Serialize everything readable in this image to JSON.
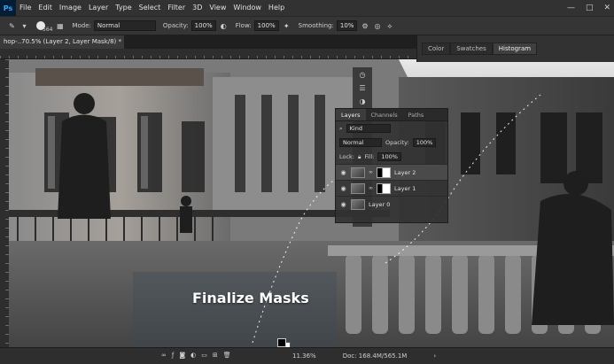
{
  "app": {
    "logo": "Ps"
  },
  "menu": [
    "File",
    "Edit",
    "Image",
    "Layer",
    "Type",
    "Select",
    "Filter",
    "3D",
    "View",
    "Window",
    "Help"
  ],
  "window_controls": [
    "—",
    "□",
    "✕"
  ],
  "options": {
    "brush_size": "564",
    "mode_label": "Mode:",
    "mode_value": "Normal",
    "opacity_label": "Opacity:",
    "opacity_value": "100%",
    "flow_label": "Flow:",
    "flow_value": "100%",
    "smoothing_label": "Smoothing:",
    "smoothing_value": "10%"
  },
  "doc_tab": {
    "title": "hop-..70.5% (Layer 2, Layer Mask/8) *",
    "close": "✕"
  },
  "right_panel": {
    "tabs": [
      "Color",
      "Swatches",
      "Histogram"
    ],
    "active": 2
  },
  "layers_panel": {
    "tabs": [
      "Layers",
      "Channels",
      "Paths"
    ],
    "kind": "Kind",
    "blend_mode": "Normal",
    "opacity_label": "Opacity:",
    "opacity_value": "100%",
    "lock_label": "Lock:",
    "fill_label": "Fill:",
    "fill_value": "100%",
    "layers": [
      {
        "name": "Layer 2",
        "has_mask": true,
        "selected": true
      },
      {
        "name": "Layer 1",
        "has_mask": true,
        "selected": false
      },
      {
        "name": "Layer 0",
        "has_mask": false,
        "selected": false
      }
    ]
  },
  "status": {
    "zoom": "11.36%",
    "doc": "Doc: 168.4M/565.1M"
  },
  "caption": "Finalize Masks"
}
